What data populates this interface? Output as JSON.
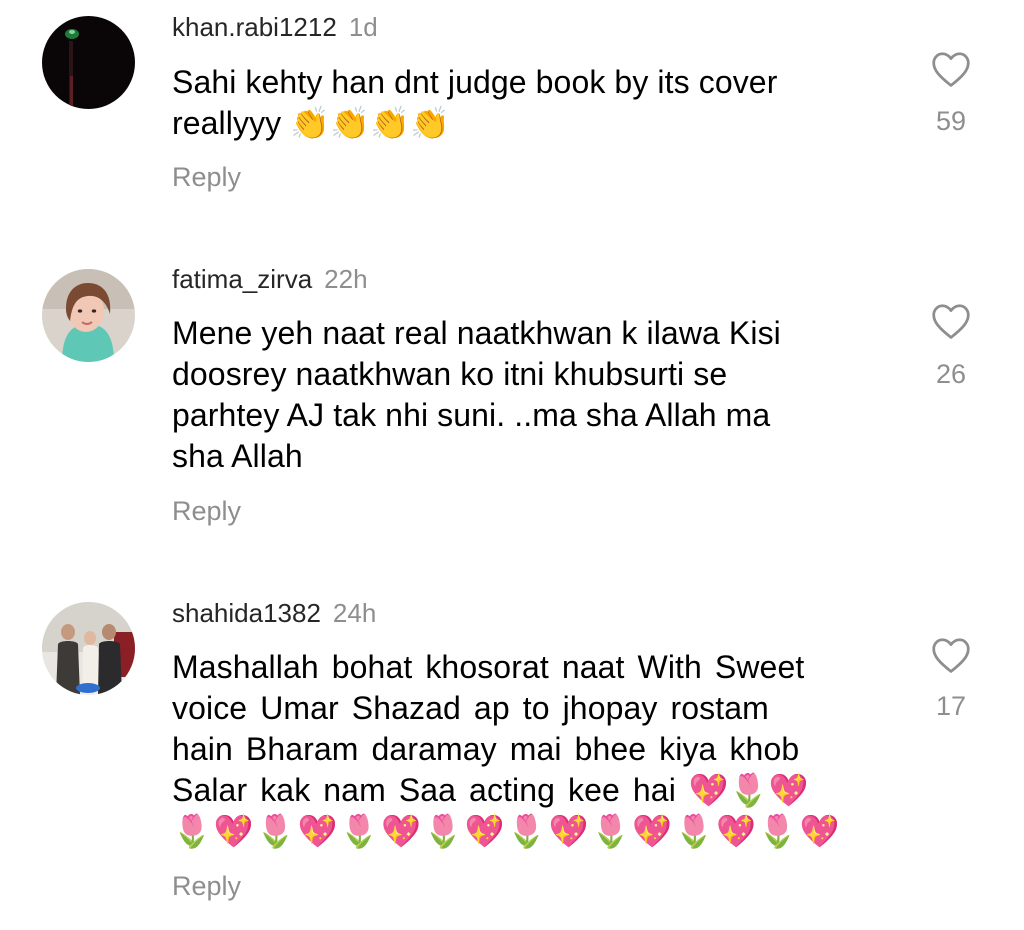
{
  "comments": [
    {
      "username": "khan.rabi1212",
      "time": "1d",
      "lines": [
        "Sahi kehty han dnt judge book by its cover",
        "reallyyy 👏👏👏👏"
      ],
      "reply": "Reply",
      "likes": "59",
      "avatar_icon": "dark-night-photo-avatar"
    },
    {
      "username": "fatima_zirva",
      "time": "22h",
      "lines": [
        "Mene yeh naat real naatkhwan k ilawa  Kisi",
        "doosrey naatkhwan ko itni khubsurti se",
        "parhtey AJ tak nhi suni. ..ma sha Allah ma",
        "sha Allah"
      ],
      "reply": "Reply",
      "likes": "26",
      "avatar_icon": "woman-portrait-avatar"
    },
    {
      "username": "shahida1382",
      "time": "24h",
      "lines": [
        "Mashallah bohat khosorat naat With Sweet",
        "voice Umar Shazad ap to jhopay rostam",
        "hain Bharam daramay mai bhee kiya khob",
        "Salar kak nam Saa acting kee hai 💖🌷💖",
        "🌷💖🌷💖🌷💖🌷💖🌷💖🌷💖🌷💖🌷💖"
      ],
      "reply": "Reply",
      "likes": "17",
      "avatar_icon": "group-photo-avatar"
    }
  ],
  "colors": {
    "username": "#262626",
    "secondary": "#8e8e8e",
    "text": "#000000"
  },
  "icons": {
    "like": "heart-outline-icon"
  }
}
